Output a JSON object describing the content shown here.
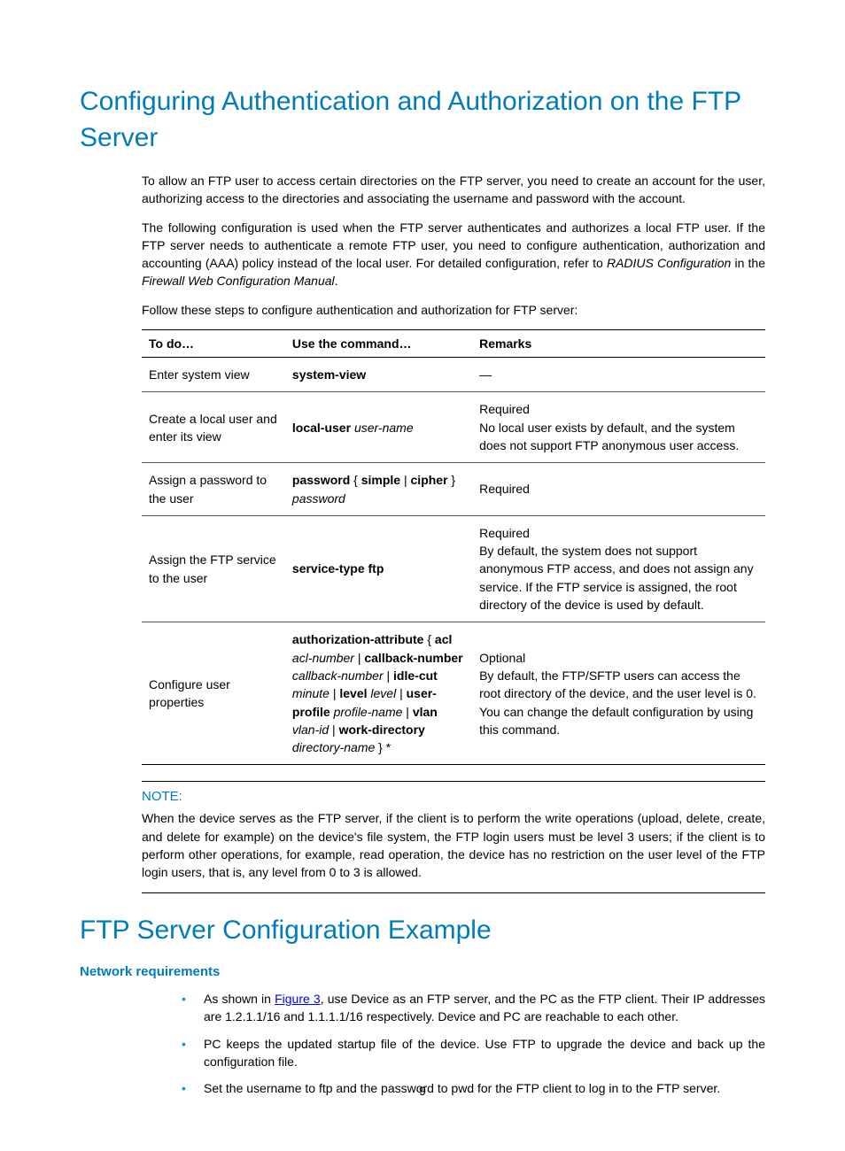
{
  "heading1": "Configuring Authentication and Authorization on the FTP Server",
  "para1": "To allow an FTP user to access certain directories on the FTP server, you need to create an account for the user, authorizing access to the directories and associating the username and password with the account.",
  "para2_a": "The following configuration is used when the FTP server authenticates and authorizes a local FTP user. If the FTP server needs to authenticate a remote FTP user, you need to configure authentication, authorization and accounting (AAA) policy instead of the local user. For detailed configuration, refer to ",
  "para2_i1": "RADIUS Configuration",
  "para2_b": " in the ",
  "para2_i2": "Firewall Web Configuration Manual",
  "para2_c": ".",
  "para3": "Follow these steps to configure authentication and authorization for FTP server:",
  "table": {
    "headers": [
      "To do…",
      "Use the command…",
      "Remarks"
    ],
    "rows": [
      {
        "todo": "Enter system view",
        "cmd": [
          {
            "t": "system-view",
            "s": "b"
          }
        ],
        "remarks": [
          {
            "t": "—"
          }
        ]
      },
      {
        "todo": "Create a local user and enter its view",
        "cmd": [
          {
            "t": "local-user",
            "s": "b"
          },
          {
            "t": " "
          },
          {
            "t": "user-name",
            "s": "i"
          }
        ],
        "remarks": [
          {
            "t": "Required"
          },
          {
            "br": true
          },
          {
            "t": "No local user exists by default, and the system does not support FTP anonymous user access."
          }
        ]
      },
      {
        "todo": "Assign a password to the user",
        "cmd": [
          {
            "t": "password",
            "s": "b"
          },
          {
            "t": " { "
          },
          {
            "t": "simple",
            "s": "b"
          },
          {
            "t": " | "
          },
          {
            "t": "cipher",
            "s": "b"
          },
          {
            "t": " } "
          },
          {
            "t": "password",
            "s": "i"
          }
        ],
        "remarks": [
          {
            "t": "Required"
          }
        ]
      },
      {
        "todo": "Assign the FTP service to the user",
        "cmd": [
          {
            "t": "service-type ftp",
            "s": "b"
          }
        ],
        "remarks": [
          {
            "t": "Required"
          },
          {
            "br": true
          },
          {
            "t": "By default, the system does not support anonymous FTP access, and does not assign any service. If the FTP service is assigned, the root directory of the device is used by default."
          }
        ]
      },
      {
        "todo": "Configure user properties",
        "cmd": [
          {
            "t": "authorization-attribute",
            "s": "b"
          },
          {
            "t": " { "
          },
          {
            "t": "acl",
            "s": "b"
          },
          {
            "t": " "
          },
          {
            "t": "acl-number",
            "s": "i"
          },
          {
            "t": " | "
          },
          {
            "t": "callback-number",
            "s": "b"
          },
          {
            "t": " "
          },
          {
            "t": "callback-number",
            "s": "i"
          },
          {
            "t": " | "
          },
          {
            "t": "idle-cut",
            "s": "b"
          },
          {
            "t": " "
          },
          {
            "t": "minute",
            "s": "i"
          },
          {
            "t": " | "
          },
          {
            "t": "level",
            "s": "b"
          },
          {
            "t": " "
          },
          {
            "t": "level",
            "s": "i"
          },
          {
            "t": " | "
          },
          {
            "t": "user-profile",
            "s": "b"
          },
          {
            "t": " "
          },
          {
            "t": "profile-name",
            "s": "i"
          },
          {
            "t": " | "
          },
          {
            "t": "vlan",
            "s": "b"
          },
          {
            "t": " "
          },
          {
            "t": "vlan-id",
            "s": "i"
          },
          {
            "t": " | "
          },
          {
            "t": "work-directory",
            "s": "b"
          },
          {
            "t": " "
          },
          {
            "t": "directory-name",
            "s": "i"
          },
          {
            "t": " } *"
          }
        ],
        "remarks": [
          {
            "t": "Optional"
          },
          {
            "br": true
          },
          {
            "t": "By default, the FTP/SFTP users can access the root directory of the device, and the user level is 0. You can change the default configuration by using this command."
          }
        ]
      }
    ]
  },
  "note_label": "NOTE:",
  "note_body": "When the device serves as the FTP server, if the client is to perform the write operations (upload, delete, create, and delete for example) on the device's file system, the FTP login users must be level 3 users; if the client is to perform other operations, for example, read operation, the device has no restriction on the user level of the FTP login users, that is, any level from 0 to 3 is allowed.",
  "heading2": "FTP Server Configuration Example",
  "subheading": "Network requirements",
  "bullets": [
    {
      "parts": [
        {
          "t": "As shown in "
        },
        {
          "t": "Figure 3",
          "link": true
        },
        {
          "t": ", use Device as an FTP server, and the PC as the FTP client. Their IP addresses are 1.2.1.1/16 and 1.1.1.1/16 respectively. Device and PC are reachable to each other."
        }
      ]
    },
    {
      "parts": [
        {
          "t": "PC keeps the updated startup file of the device. Use FTP to upgrade the device and back up the configuration file."
        }
      ]
    },
    {
      "parts": [
        {
          "t": "Set the username to "
        },
        {
          "t": "ftp",
          "s": "b"
        },
        {
          "t": " and the password to "
        },
        {
          "t": "pwd",
          "s": "b"
        },
        {
          "t": " for the FTP client to log in to the FTP server."
        }
      ]
    }
  ],
  "page_number": "9"
}
